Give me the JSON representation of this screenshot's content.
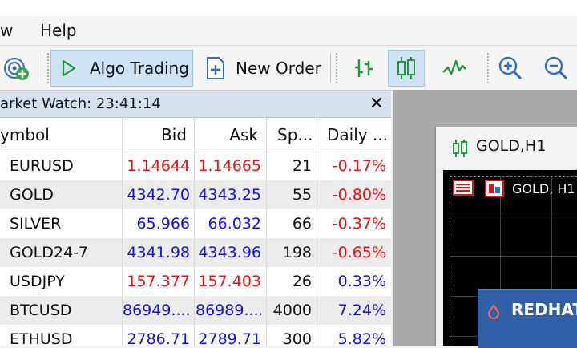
{
  "menu": {
    "view_fragment": "w",
    "help": "Help"
  },
  "toolbar": {
    "algo_trading": "Algo Trading",
    "new_order": "New Order"
  },
  "market_watch": {
    "title": "arket Watch: 23:41:14",
    "columns": {
      "symbol": "ymbol",
      "bid": "Bid",
      "ask": "Ask",
      "spread": "Sp...",
      "daily": "Daily ..."
    },
    "rows": [
      {
        "symbol": "EURUSD",
        "bid": "1.14644",
        "ask": "1.14665",
        "spread": "21",
        "daily": "-0.17%",
        "trend": "down",
        "daily_trend": "down"
      },
      {
        "symbol": "GOLD",
        "bid": "4342.70",
        "ask": "4343.25",
        "spread": "55",
        "daily": "-0.80%",
        "trend": "up",
        "daily_trend": "down"
      },
      {
        "symbol": "SILVER",
        "bid": "65.966",
        "ask": "66.032",
        "spread": "66",
        "daily": "-0.37%",
        "trend": "up",
        "daily_trend": "down"
      },
      {
        "symbol": "GOLD24-7",
        "bid": "4341.98",
        "ask": "4343.96",
        "spread": "198",
        "daily": "-0.65%",
        "trend": "up",
        "daily_trend": "down"
      },
      {
        "symbol": "USDJPY",
        "bid": "157.377",
        "ask": "157.403",
        "spread": "26",
        "daily": "0.33%",
        "trend": "down",
        "daily_trend": "up"
      },
      {
        "symbol": "BTCUSD",
        "bid": "86949....",
        "ask": "86989....",
        "spread": "4000",
        "daily": "7.24%",
        "trend": "up",
        "daily_trend": "up"
      },
      {
        "symbol": "ETHUSD",
        "bid": "2786.71",
        "ask": "2789.71",
        "spread": "300",
        "daily": "5.82%",
        "trend": "up",
        "daily_trend": "up"
      }
    ]
  },
  "chart": {
    "tab_title": "GOLD,H1",
    "inner_label": "GOLD, H1"
  },
  "panel": {
    "title": "REDHAT"
  },
  "colors": {
    "up": "#1212e8",
    "down": "#e81212",
    "accent": "#2f5fa6",
    "active": "#cfe3f5"
  },
  "icons": [
    "signals-icon",
    "algo-trading-play-icon",
    "new-order-icon",
    "bar-chart-icon",
    "candlestick-icon",
    "line-chart-icon",
    "zoom-in-icon",
    "zoom-out-icon",
    "close-icon",
    "chart-tab-icon"
  ]
}
